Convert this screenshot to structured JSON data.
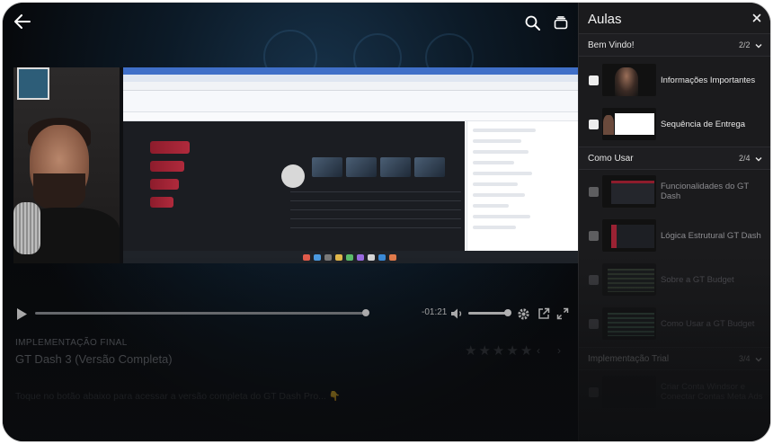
{
  "player": {
    "time_remaining": "-01:21",
    "progress_fraction": 0.9,
    "volume_fraction": 0.9
  },
  "lesson_meta": {
    "module": "IMPLEMENTAÇÃO FINAL",
    "title": "GT Dash 3 (Versão Completa)",
    "description": "Toque no botão abaixo para acessar a versão completa do GT Dash Pro... 👇",
    "rating_max": 5
  },
  "sidebar": {
    "title": "Aulas",
    "sections": [
      {
        "name": "Bem Vindo!",
        "count": "2/2",
        "lessons": [
          {
            "label": "Informações Importantes"
          },
          {
            "label": "Sequência de Entrega"
          }
        ]
      },
      {
        "name": "Como Usar",
        "count": "2/4",
        "lessons": [
          {
            "label": "Funcionalidades do GT Dash"
          },
          {
            "label": "Lógica Estrutural GT Dash"
          },
          {
            "label": "Sobre a GT Budget"
          },
          {
            "label": "Como Usar a GT Budget"
          }
        ]
      },
      {
        "name": "Implementação Trial",
        "count": "3/4",
        "lessons": [
          {
            "label": "Criar Conta Windsor e Conectar Contas Meta Ads"
          }
        ]
      }
    ]
  },
  "colors": {
    "panel_bg": "#1b1b1d",
    "stage_bg": "#0c1a27",
    "accent_red": "#b02a3c"
  },
  "icons": {
    "back": "arrow-left-icon",
    "search": "search-icon",
    "courses": "stack-icon",
    "close": "close-icon",
    "play": "play-icon",
    "volume": "volume-icon",
    "settings": "gear-icon",
    "share": "share-icon",
    "fullscreen": "fullscreen-icon",
    "chevron": "chevron-down-icon",
    "star": "star-icon",
    "prev": "chevron-left-icon",
    "next": "chevron-right-icon"
  }
}
